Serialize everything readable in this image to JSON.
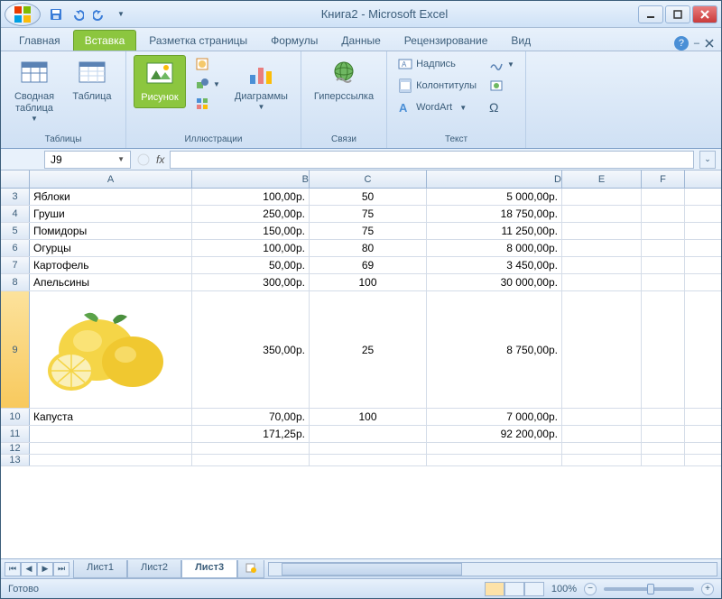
{
  "title": "Книга2 - Microsoft Excel",
  "tabs": {
    "home": "Главная",
    "insert": "Вставка",
    "layout": "Разметка страницы",
    "formulas": "Формулы",
    "data": "Данные",
    "review": "Рецензирование",
    "view": "Вид"
  },
  "ribbon": {
    "tables_group": "Таблицы",
    "pivot": "Сводная\nтаблица",
    "table": "Таблица",
    "illustrations_group": "Иллюстрации",
    "picture": "Рисунок",
    "charts": "Диаграммы",
    "links_group": "Связи",
    "hyperlink": "Гиперссылка",
    "text_group": "Текст",
    "textbox": "Надпись",
    "headerfooter": "Колонтитулы",
    "wordart": "WordArt",
    "omega": "Ω"
  },
  "namebox": "J9",
  "fx": "fx",
  "columns": [
    "A",
    "B",
    "C",
    "D",
    "E",
    "F"
  ],
  "rows": [
    {
      "n": "3",
      "a": "Яблоки",
      "b": "100,00р.",
      "c": "50",
      "d": "5 000,00р."
    },
    {
      "n": "4",
      "a": "Груши",
      "b": "250,00р.",
      "c": "75",
      "d": "18 750,00р."
    },
    {
      "n": "5",
      "a": "Помидоры",
      "b": "150,00р.",
      "c": "75",
      "d": "11 250,00р."
    },
    {
      "n": "6",
      "a": "Огурцы",
      "b": "100,00р.",
      "c": "80",
      "d": "8 000,00р."
    },
    {
      "n": "7",
      "a": "Картофель",
      "b": "50,00р.",
      "c": "69",
      "d": "3 450,00р."
    },
    {
      "n": "8",
      "a": "Апельсины",
      "b": "300,00р.",
      "c": "100",
      "d": "30 000,00р."
    }
  ],
  "row9": {
    "n": "9",
    "b": "350,00р.",
    "c": "25",
    "d": "8 750,00р."
  },
  "row10": {
    "n": "10",
    "a": "Капуста",
    "b": "70,00р.",
    "c": "100",
    "d": "7 000,00р."
  },
  "row11": {
    "n": "11",
    "b": "171,25р.",
    "d": "92 200,00р."
  },
  "empty_rows": [
    "12",
    "13"
  ],
  "sheets": {
    "s1": "Лист1",
    "s2": "Лист2",
    "s3": "Лист3"
  },
  "status": "Готово",
  "zoom": "100%"
}
